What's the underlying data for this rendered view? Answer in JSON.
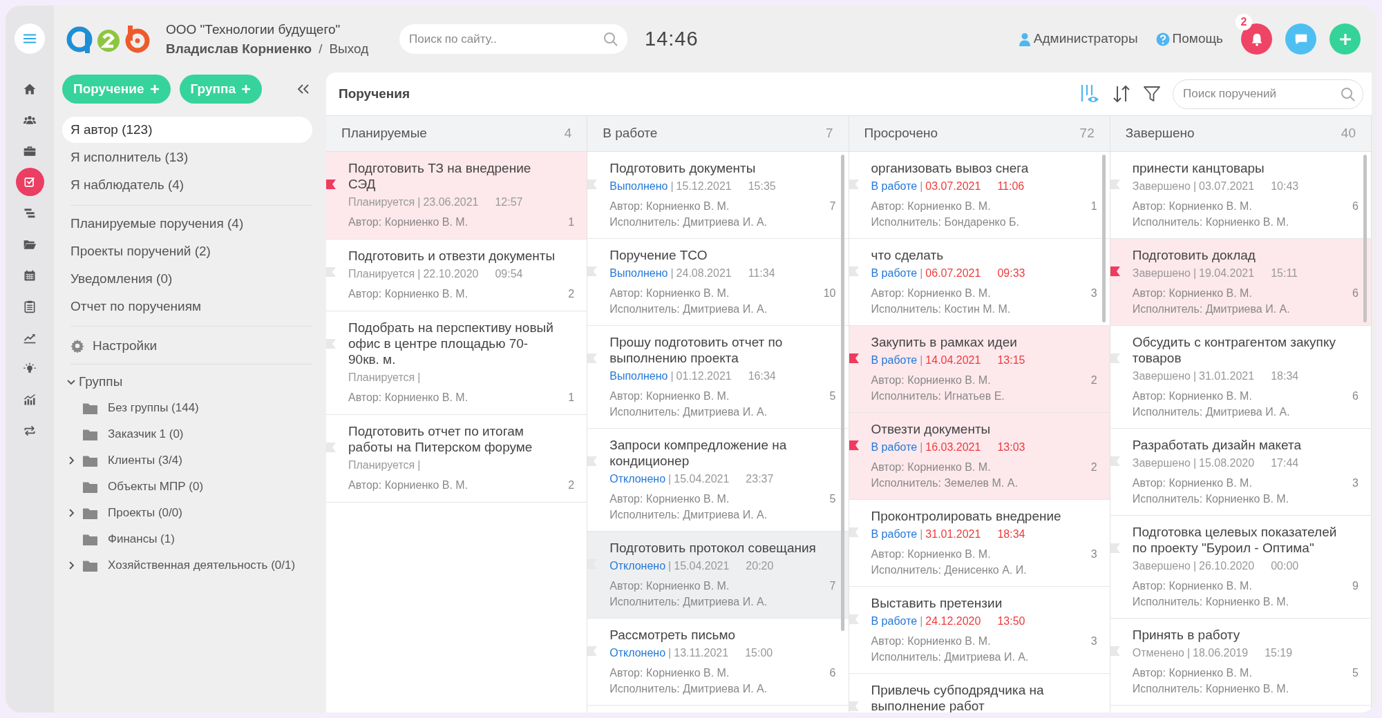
{
  "nav_rail": [
    {
      "kind": "menu"
    },
    {
      "kind": "home",
      "selected": false
    },
    {
      "kind": "users",
      "selected": false
    },
    {
      "kind": "briefcase",
      "selected": false
    },
    {
      "kind": "tasks",
      "selected": true
    },
    {
      "kind": "gantt",
      "selected": false
    },
    {
      "kind": "folder",
      "selected": false
    },
    {
      "kind": "calendar",
      "selected": false
    },
    {
      "kind": "clipboard",
      "selected": false
    },
    {
      "kind": "trend",
      "selected": false
    },
    {
      "kind": "bulb",
      "selected": false
    },
    {
      "kind": "bars",
      "selected": false
    },
    {
      "kind": "repeat",
      "selected": false
    }
  ],
  "header": {
    "company": "ООО \"Технологии будущего\"",
    "user": "Владислав Корниенко",
    "separator": "/",
    "logout": "Выход",
    "search": {
      "placeholder": "Поиск по сайту.."
    },
    "time": "14:46",
    "links": [
      {
        "kind": "user",
        "label": "Администраторы"
      },
      {
        "kind": "help",
        "label": "Помощь"
      }
    ],
    "actions": [
      {
        "kind": "bell",
        "badge": "2"
      },
      {
        "kind": "chat"
      },
      {
        "kind": "add"
      }
    ]
  },
  "sidebar": {
    "buttons": [
      "Поручение",
      "Группа"
    ],
    "filters": [
      {
        "label": "Я автор (123)",
        "selected": true
      },
      {
        "label": "Я исполнитель (13)",
        "selected": false
      },
      {
        "label": "Я наблюдатель (4)",
        "selected": false
      }
    ],
    "lists": [
      "Планируемые поручения (4)",
      "Проекты поручений (2)",
      "Уведомления (0)",
      "Отчет по поручениям"
    ],
    "settings": "Настройки",
    "groups": {
      "label": "Группы",
      "expanded": true,
      "children": [
        {
          "label": "Без группы (144)"
        },
        {
          "label": "Заказчик 1 (0)"
        },
        {
          "label": "Клиенты (3/4)",
          "expanded": false
        },
        {
          "label": "Объекты МПР (0)"
        },
        {
          "label": "Проекты (0/0)",
          "expanded": false
        },
        {
          "label": "Финансы (1)"
        },
        {
          "label": "Хозяйственная деятельность (0/1)",
          "expanded": false
        }
      ]
    }
  },
  "board": {
    "title": "Поручения",
    "search": {
      "placeholder": "Поиск поручений"
    },
    "columns": [
      {
        "title": "Планируемые",
        "count": "4",
        "cards": [
          {
            "title": "Подготовить ТЗ на внедрение СЭД",
            "status": "Планируется",
            "status_link": false,
            "divider": "|",
            "date": "23.06.2021",
            "time": "12:57",
            "overdue": false,
            "author": "Автор: Корниенко В. М.",
            "count": "1",
            "flagged": true,
            "selected": false
          },
          {
            "title": "Подготовить и отвезти документы",
            "status": "Планируется",
            "status_link": false,
            "divider": "|",
            "date": "22.10.2020",
            "time": "09:54",
            "overdue": false,
            "author": "Автор: Корниенко В. М.",
            "count": "2",
            "flagged": false,
            "selected": false
          },
          {
            "title": "Подобрать на перспективу новый офис в центре площадью 70-90кв. м.",
            "status": "Планируется",
            "status_link": false,
            "divider": "|",
            "author": "Автор: Корниенко В. М.",
            "count": "1",
            "flagged": false,
            "selected": false
          },
          {
            "title": "Подготовить отчет по итогам работы на Питерском форуме",
            "status": "Планируется",
            "status_link": false,
            "divider": "|",
            "author": "Автор: Корниенко В. М.",
            "count": "2",
            "flagged": false,
            "selected": false
          }
        ]
      },
      {
        "title": "В работе",
        "count": "7",
        "scrollbar": true,
        "cards": [
          {
            "title": "Подготовить документы",
            "status": "Выполнено",
            "status_link": true,
            "divider": "|",
            "date": "15.12.2021",
            "time": "15:35",
            "overdue": false,
            "author": "Автор: Корниенко В. М.",
            "executor": "Исполнитель: Дмитриева И. А.",
            "count": "7",
            "flagged": false,
            "selected": false
          },
          {
            "title": "Поручение ТСО",
            "status": "Выполнено",
            "status_link": true,
            "divider": "|",
            "date": "24.08.2021",
            "time": "11:34",
            "overdue": false,
            "author": "Автор: Корниенко В. М.",
            "executor": "Исполнитель: Дмитриева И. А.",
            "count": "10",
            "flagged": false,
            "selected": false
          },
          {
            "title": "Прошу подготовить отчет по выполнению проекта",
            "status": "Выполнено",
            "status_link": true,
            "divider": "|",
            "date": "01.12.2021",
            "time": "16:34",
            "overdue": false,
            "author": "Автор: Корниенко В. М.",
            "executor": "Исполнитель: Дмитриева И. А.",
            "count": "5",
            "flagged": false,
            "selected": false
          },
          {
            "title": "Запроси компредложение на кондиционер",
            "status": "Отклонено",
            "status_link": true,
            "divider": "|",
            "date": "15.04.2021",
            "time": "23:37",
            "overdue": false,
            "author": "Автор: Корниенко В. М.",
            "executor": "Исполнитель: Дмитриева И. А.",
            "count": "5",
            "flagged": false,
            "selected": false
          },
          {
            "title": "Подготовить протокол совещания",
            "status": "Отклонено",
            "status_link": true,
            "divider": "|",
            "date": "15.04.2021",
            "time": "20:20",
            "overdue": false,
            "author": "Автор: Корниенко В. М.",
            "executor": "Исполнитель: Дмитриева И. А.",
            "count": "7",
            "flagged": false,
            "selected": true
          },
          {
            "title": "Рассмотреть письмо",
            "status": "Отклонено",
            "status_link": true,
            "divider": "|",
            "date": "13.11.2021",
            "time": "15:00",
            "overdue": false,
            "author": "Автор: Корниенко В. М.",
            "executor": "Исполнитель: Дмитриева И. А.",
            "count": "6",
            "flagged": false,
            "selected": false
          }
        ]
      },
      {
        "title": "Просрочено",
        "count": "72",
        "scrollbar": true,
        "cards": [
          {
            "title": "организовать вывоз снега",
            "status": "В работе",
            "status_link": true,
            "divider": "|",
            "date": "03.07.2021",
            "time": "11:06",
            "overdue": true,
            "author": "Автор: Корниенко В. М.",
            "executor": "Исполнитель: Бондаренко Б.",
            "count": "1",
            "flagged": false,
            "selected": false
          },
          {
            "title": "что сделать",
            "status": "В работе",
            "status_link": true,
            "divider": "|",
            "date": "06.07.2021",
            "time": "09:33",
            "overdue": true,
            "author": "Автор: Корниенко В. М.",
            "executor": "Исполнитель: Костин М. М.",
            "count": "3",
            "flagged": false,
            "selected": false
          },
          {
            "title": "Закупить в рамках идеи",
            "status": "В работе",
            "status_link": true,
            "divider": "|",
            "date": "14.04.2021",
            "time": "13:15",
            "overdue": true,
            "author": "Автор: Корниенко В. М.",
            "executor": "Исполнитель: Игнатьев Е.",
            "count": "2",
            "flagged": true,
            "selected": false
          },
          {
            "title": "Отвезти документы",
            "status": "В работе",
            "status_link": true,
            "divider": "|",
            "date": "16.03.2021",
            "time": "13:03",
            "overdue": true,
            "author": "Автор: Корниенко В. М.",
            "executor": "Исполнитель: Земелев М. А.",
            "count": "2",
            "flagged": true,
            "selected": false
          },
          {
            "title": "Проконтролировать внедрение",
            "status": "В работе",
            "status_link": true,
            "divider": "|",
            "date": "31.01.2021",
            "time": "18:34",
            "overdue": true,
            "author": "Автор: Корниенко В. М.",
            "executor": "Исполнитель: Денисенко А. И.",
            "count": "3",
            "flagged": false,
            "selected": false
          },
          {
            "title": "Выставить претензии",
            "status": "В работе",
            "status_link": true,
            "divider": "|",
            "date": "24.12.2020",
            "time": "13:50",
            "overdue": true,
            "author": "Автор: Корниенко В. М.",
            "executor": "Исполнитель: Дмитриева И. А.",
            "count": "3",
            "flagged": false,
            "selected": false
          },
          {
            "title": "Привлечь субподрядчика на выполнение работ",
            "flagged": false,
            "selected": false
          }
        ]
      },
      {
        "title": "Завершено",
        "count": "40",
        "scrollbar": true,
        "cards": [
          {
            "title": "принести канцтовары",
            "status": "Завершено",
            "status_link": false,
            "divider": "|",
            "date": "03.07.2021",
            "time": "10:43",
            "overdue": false,
            "author": "Автор: Корниенко В. М.",
            "executor": "Исполнитель: Корниенко В. М.",
            "count": "6",
            "flagged": false,
            "selected": false
          },
          {
            "title": "Подготовить доклад",
            "status": "Завершено",
            "status_link": false,
            "divider": "|",
            "date": "19.04.2021",
            "time": "15:11",
            "overdue": false,
            "author": "Автор: Корниенко В. М.",
            "executor": "Исполнитель: Дмитриева И. А.",
            "count": "6",
            "flagged": true,
            "selected": false
          },
          {
            "title": "Обсудить с контрагентом закупку товаров",
            "status": "Завершено",
            "status_link": false,
            "divider": "|",
            "date": "31.01.2021",
            "time": "18:34",
            "overdue": false,
            "author": "Автор: Корниенко В. М.",
            "executor": "Исполнитель: Дмитриева И. А.",
            "count": "6",
            "flagged": false,
            "selected": false
          },
          {
            "title": "Разработать дизайн макета",
            "status": "Завершено",
            "status_link": false,
            "divider": "|",
            "date": "15.08.2020",
            "time": "17:44",
            "overdue": false,
            "author": "Автор: Корниенко В. М.",
            "executor": "Исполнитель: Корниенко В. М.",
            "count": "3",
            "flagged": false,
            "selected": false
          },
          {
            "title": "Подготовка целевых показателей по проекту \"Буроил - Оптима\"",
            "status": "Завершено",
            "status_link": false,
            "divider": "|",
            "date": "26.10.2020",
            "time": "00:00",
            "overdue": false,
            "author": "Автор: Корниенко В. М.",
            "executor": "Исполнитель: Корниенко В. М.",
            "count": "9",
            "flagged": false,
            "selected": false
          },
          {
            "title": "Принять в работу",
            "status": "Отменено",
            "status_link": false,
            "divider": "|",
            "date": "18.06.2019",
            "time": "15:19",
            "overdue": false,
            "author": "Автор: Корниенко В. М.",
            "executor": "Исполнитель: Корниенко В. М.",
            "count": "5",
            "flagged": false,
            "selected": false
          }
        ]
      }
    ]
  }
}
